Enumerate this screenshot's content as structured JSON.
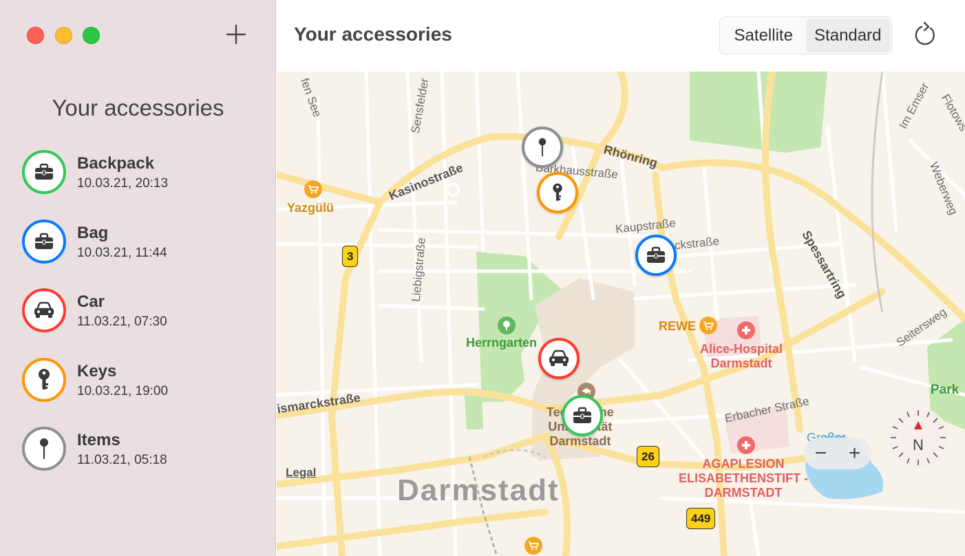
{
  "window": {
    "title": "Your accessories"
  },
  "sidebar": {
    "title": "Your accessories",
    "add_icon": "plus-icon",
    "items": [
      {
        "name": "Backpack",
        "date": "10.03.21, 20:13",
        "icon": "briefcase-icon",
        "color": "#34c759"
      },
      {
        "name": "Bag",
        "date": "10.03.21, 11:44",
        "icon": "briefcase-icon",
        "color": "#0a7aff"
      },
      {
        "name": "Car",
        "date": "11.03.21, 07:30",
        "icon": "car-icon",
        "color": "#ff3b30"
      },
      {
        "name": "Keys",
        "date": "10.03.21, 19:00",
        "icon": "key-icon",
        "color": "#ff9500"
      },
      {
        "name": "Items",
        "date": "11.03.21, 05:18",
        "icon": "pin-icon",
        "color": "#8e8e93"
      }
    ]
  },
  "toolbar": {
    "title": "Your accessories",
    "map_modes": [
      "Satellite",
      "Standard"
    ],
    "selected_mode": "Standard",
    "refresh_icon": "refresh-icon"
  },
  "map": {
    "city_label": "Darmstadt",
    "streets": {
      "kasinostrasse": "Kasinostraße",
      "rhoenring": "Rhönring",
      "barkhausstrasse": "Barkhausstraße",
      "kaupstrasse": "Kaupstraße",
      "ckstrasse": "ckstraße",
      "spessartring": "Spessartring",
      "liebigstrasse": "Liebigstraße",
      "sensfelder": "Sensfelder",
      "fen_see": "fen See",
      "bismarckstrasse": "ismarckstraße",
      "erbacher": "Erbacher Straße",
      "seitersweg": "Seitersweg",
      "weberweg": "Weberweg",
      "im_emser": "Im Emser",
      "flotow": "Flotows"
    },
    "places": {
      "yazgulu": "Yazgülü",
      "herrngarten": "Herrngarten",
      "rewe": "REWE",
      "alice_hospital": [
        "Alice-Hospital",
        "Darmstadt"
      ],
      "university": [
        "Technische",
        "Universität",
        "Darmstadt"
      ],
      "agaplesion": [
        "AGAPLESION",
        "ELISABETHENSTIFT -",
        "DARMSTADT"
      ],
      "grosser": "Großer",
      "park": "Park"
    },
    "shields": [
      "3",
      "26",
      "449"
    ],
    "legal": "Legal",
    "zoom_out": "−",
    "zoom_in": "+",
    "compass_label": "N",
    "pins": [
      {
        "name": "Items",
        "icon": "pin-icon",
        "color": "#8e8e93"
      },
      {
        "name": "Keys",
        "icon": "key-icon",
        "color": "#ff9500"
      },
      {
        "name": "Bag",
        "icon": "briefcase-icon",
        "color": "#0a7aff"
      },
      {
        "name": "Car",
        "icon": "car-icon",
        "color": "#ff3b30"
      },
      {
        "name": "Backpack",
        "icon": "briefcase-icon",
        "color": "#34c759"
      }
    ],
    "colors": {
      "park": "#c4e6b0",
      "road_major": "#fbe29a",
      "road_minor": "#ffffff",
      "water": "#a6d6f0",
      "campus": "#ece3d6",
      "hospital": "#f4dede"
    }
  }
}
